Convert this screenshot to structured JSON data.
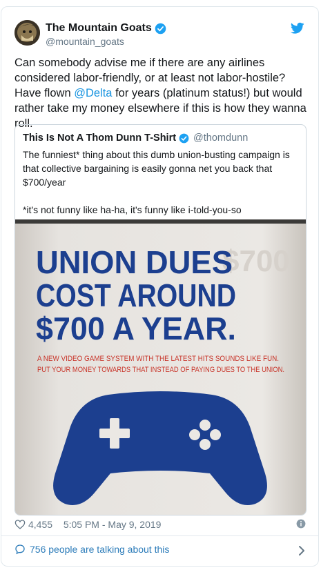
{
  "tweet": {
    "author_name": "The Mountain Goats",
    "author_handle": "@mountain_goats",
    "text_before": "Can somebody advise me if there are any airlines considered labor-friendly, or at least not labor-hostile? Have flown ",
    "mention": "@Delta",
    "text_after": " for years (platinum status!) but would rather take my money elsewhere if this is how they wanna roll."
  },
  "quoted": {
    "author_name": "This Is Not A Thom Dunn T-Shirt",
    "author_handle": "@thomdunn",
    "text_line1": "The funniest* thing about this dumb union-busting campaign is that collective bargaining is easily gonna net you back that $700/year",
    "text_line2": "*it's not funny like ha-ha, it's funny like i-told-you-so",
    "poster": {
      "headline1": "UNION DUES",
      "headline2": "COST AROUND",
      "headline3": "$700 A YEAR.",
      "ghost": "$700",
      "sub1": "A NEW VIDEO GAME SYSTEM WITH THE LATEST HITS SOUNDS LIKE FUN.",
      "sub2": "PUT YOUR MONEY TOWARDS THAT INSTEAD OF PAYING DUES TO THE UNION."
    }
  },
  "footer": {
    "likes": "4,455",
    "timestamp": "5:05 PM - May 9, 2019",
    "talking": "756 people are talking about this"
  },
  "colors": {
    "accent": "#1b95e0",
    "poster_blue": "#1c3f8f",
    "poster_red": "#c8352a"
  },
  "icons": {
    "verified": "verified-badge-icon",
    "bird": "twitter-bird-icon",
    "heart": "heart-icon",
    "info": "info-icon",
    "bubble": "speech-bubble-icon",
    "chevron": "chevron-right-icon"
  }
}
